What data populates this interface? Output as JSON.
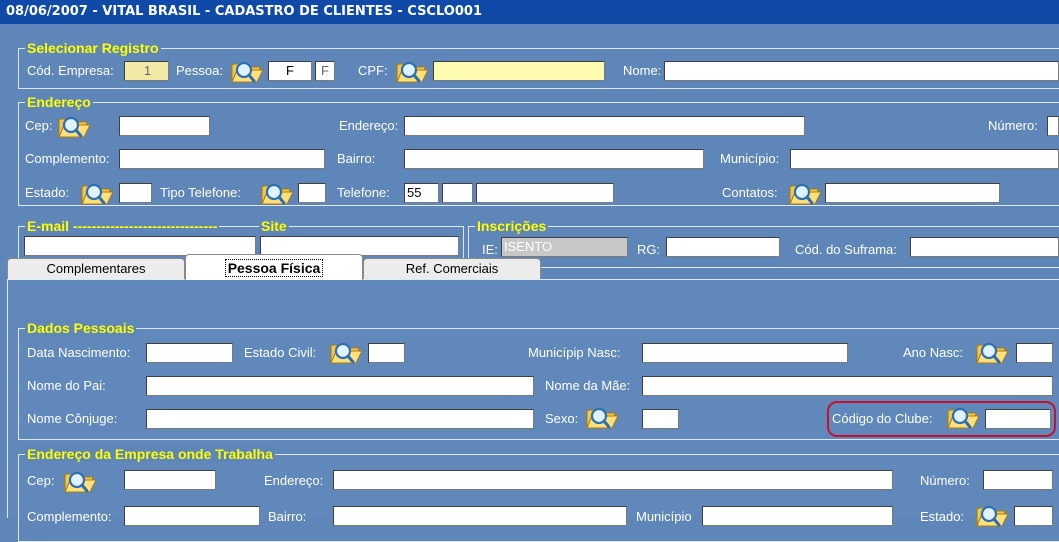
{
  "window": {
    "title": "08/06/2007 - VITAL BRASIL - CADASTRO DE CLIENTES - CSCLO001"
  },
  "selecionar": {
    "legend": "Selecionar Registro",
    "cod_empresa_label": "Cód. Empresa:",
    "cod_empresa_value": "1",
    "pessoa_label": "Pessoa:",
    "pessoa_value": "F",
    "pessoa_code": "F",
    "cpf_label": "CPF:",
    "cpf_value": "",
    "nome_label": "Nome:",
    "nome_value": ""
  },
  "endereco": {
    "legend": "Endereço",
    "cep_label": "Cep:",
    "endereco_label": "Endereço:",
    "numero_label": "Número:",
    "complemento_label": "Complemento:",
    "bairro_label": "Bairro:",
    "municipio_label": "Município:",
    "estado_label": "Estado:",
    "tipo_telefone_label": "Tipo Telefone:",
    "telefone_label": "Telefone:",
    "telefone_ddi": "55",
    "contatos_label": "Contatos:"
  },
  "email": {
    "legend": "E-mail -------------------------------",
    "value": ""
  },
  "site": {
    "legend": "Site",
    "value": ""
  },
  "inscricoes": {
    "legend": "Inscrições",
    "ie_label": "IE:",
    "ie_value": "ISENTO",
    "rg_label": "RG:",
    "suframa_label": "Cód. do Suframa:"
  },
  "tabs": [
    {
      "label": "Complementares",
      "active": false
    },
    {
      "label": "Pessoa Física",
      "active": true
    },
    {
      "label": "Ref. Comerciais",
      "active": false
    }
  ],
  "dados_pessoais": {
    "legend": "Dados Pessoais",
    "data_nascimento_label": "Data Nascimento:",
    "estado_civil_label": "Estado Civil:",
    "municipio_nasc_label": "Municípip Nasc:",
    "ano_nasc_label": "Ano Nasc:",
    "nome_pai_label": "Nome do Pai:",
    "nome_mae_label": "Nome da Mãe:",
    "nome_conjuge_label": "Nome Cônjuge:",
    "sexo_label": "Sexo:",
    "codigo_clube_label": "Código do Clube:"
  },
  "endereco_empresa": {
    "legend": "Endereço da Empresa onde Trabalha",
    "cep_label": "Cep:",
    "endereco_label": "Endereço:",
    "numero_label": "Número:",
    "complemento_label": "Complemento:",
    "bairro_label": "Bairro:",
    "municipio_label": "Município",
    "estado_label": "Estado:"
  },
  "icons": {
    "lookup": "folder-search-icon"
  },
  "colors": {
    "title_bar": "#0f4aa8",
    "panel": "#5e86b8",
    "legend": "#ffff00",
    "highlight": "#c8102e"
  }
}
